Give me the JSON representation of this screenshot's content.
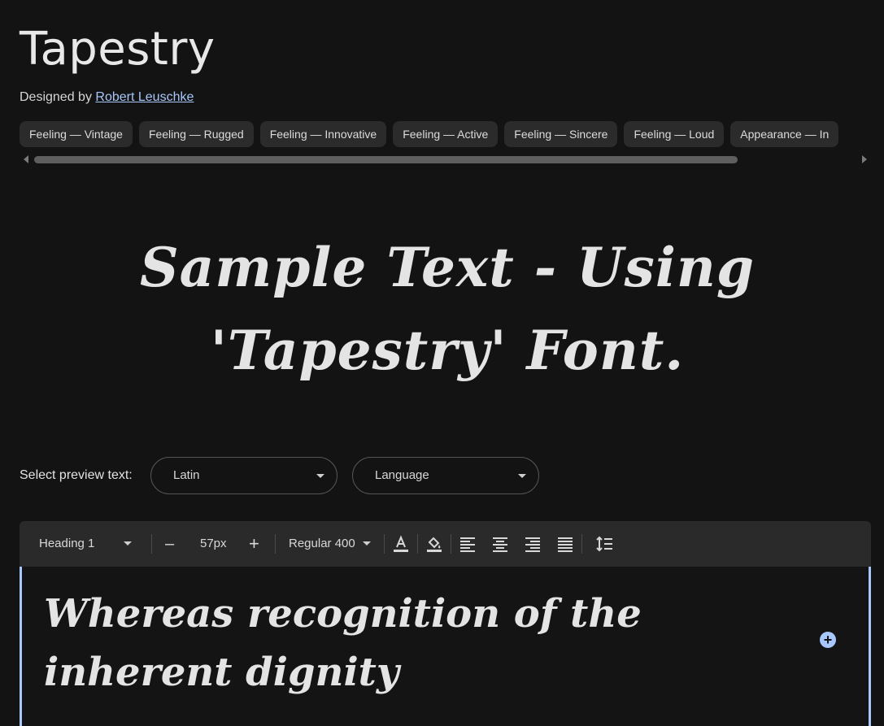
{
  "font": {
    "name": "Tapestry",
    "designed_by_label": "Designed by",
    "designer": "Robert Leuschke"
  },
  "tags": [
    "Feeling — Vintage",
    "Feeling — Rugged",
    "Feeling — Innovative",
    "Feeling — Active",
    "Feeling — Sincere",
    "Feeling — Loud",
    "Appearance — In"
  ],
  "hero": {
    "line1": "Sample Text - Using",
    "line2": "'Tapestry' Font."
  },
  "preview": {
    "label": "Select preview text:",
    "script_value": "Latin",
    "language_value": "Language"
  },
  "toolbar": {
    "style_value": "Heading 1",
    "minus": "–",
    "size_value": "57px",
    "plus": "+",
    "weight_value": "Regular 400"
  },
  "editor": {
    "text": "Whereas recognition of the inherent dignity"
  },
  "icons": {
    "text_color": "text-color-icon",
    "highlight": "highlight-color-icon",
    "align_left": "align-left-icon",
    "align_center": "align-center-icon",
    "align_right": "align-right-icon",
    "align_justify": "align-justify-icon",
    "line_height": "line-height-icon",
    "add": "add-circle-icon"
  },
  "colors": {
    "background": "#131313",
    "accent": "#a8c7fa",
    "chip": "#2b2b2b",
    "toolbar": "#2a2a2a"
  }
}
